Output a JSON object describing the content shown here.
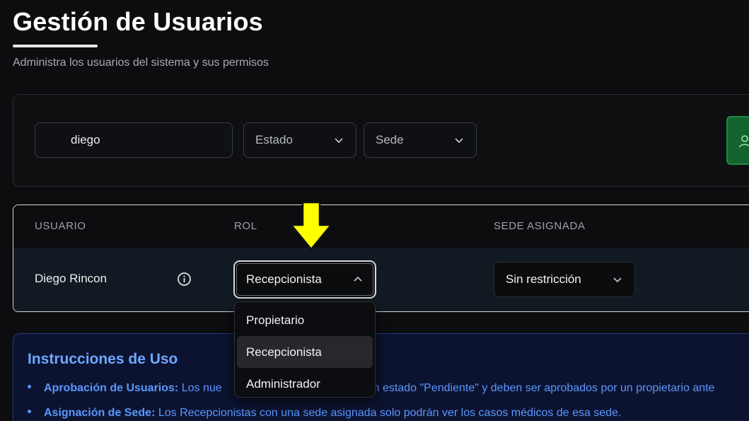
{
  "header": {
    "title": "Gestión de Usuarios",
    "subtitle": "Administra los usuarios del sistema y sus permisos"
  },
  "filters": {
    "search_value": "diego",
    "estado_label": "Estado",
    "sede_label": "Sede"
  },
  "table": {
    "columns": [
      "USUARIO",
      "ROL",
      "SEDE ASIGNADA"
    ],
    "rows": [
      {
        "user": "Diego Rincon",
        "role": "Recepcionista",
        "sede": "Sin restricción"
      }
    ]
  },
  "role_dropdown": {
    "options": [
      "Propietario",
      "Recepcionista",
      "Administrador"
    ],
    "selected": "Recepcionista"
  },
  "instructions": {
    "title": "Instrucciones de Uso",
    "items": [
      {
        "label": "Aprobación de Usuarios:",
        "text": " Los nue",
        "text_after": "n estado \"Pendiente\" y deben ser aprobados por un propietario ante"
      },
      {
        "label": "Asignación de Sede:",
        "text": " Los Recepcionistas con una sede asignada solo podrán ver los casos médicos de esa sede."
      }
    ]
  },
  "colors": {
    "accent_green": "#14632e",
    "info_blue": "#5a97ff",
    "arrow_yellow": "#ffff00"
  }
}
